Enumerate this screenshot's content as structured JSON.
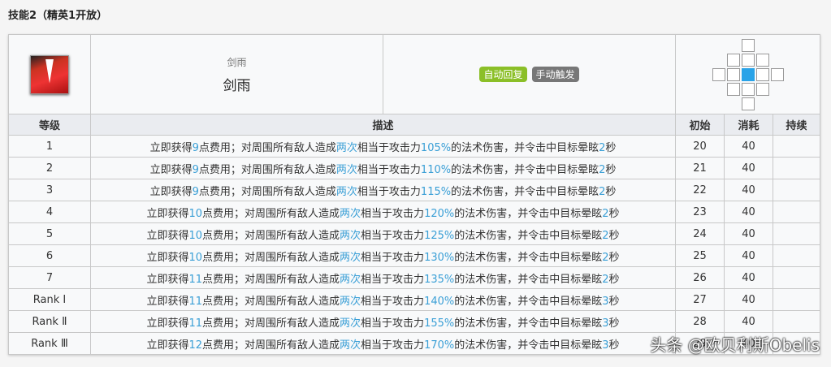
{
  "title": "技能2（精英1开放）",
  "skill": {
    "name_small": "剑雨",
    "name": "剑雨",
    "tags": [
      {
        "label": "自动回复",
        "color": "#8bbf27"
      },
      {
        "label": "手动触发",
        "color": "#777777"
      }
    ]
  },
  "headers": {
    "level": "等级",
    "desc": "描述",
    "initial": "初始",
    "cost": "消耗",
    "duration": "持续"
  },
  "desc_parts": [
    "立即获得",
    "点费用；对周围所有敌人造成",
    "两次",
    "相当于攻击力",
    "的法术伤害，并令击中目标晕眩",
    "秒"
  ],
  "rows": [
    {
      "level": "1",
      "sp": "9",
      "pct": "105%",
      "stun": "2",
      "initial": "20",
      "cost": "40",
      "duration": ""
    },
    {
      "level": "2",
      "sp": "9",
      "pct": "110%",
      "stun": "2",
      "initial": "21",
      "cost": "40",
      "duration": ""
    },
    {
      "level": "3",
      "sp": "9",
      "pct": "115%",
      "stun": "2",
      "initial": "22",
      "cost": "40",
      "duration": ""
    },
    {
      "level": "4",
      "sp": "10",
      "pct": "120%",
      "stun": "2",
      "initial": "23",
      "cost": "40",
      "duration": ""
    },
    {
      "level": "5",
      "sp": "10",
      "pct": "125%",
      "stun": "2",
      "initial": "24",
      "cost": "40",
      "duration": ""
    },
    {
      "level": "6",
      "sp": "10",
      "pct": "130%",
      "stun": "2",
      "initial": "25",
      "cost": "40",
      "duration": ""
    },
    {
      "level": "7",
      "sp": "11",
      "pct": "135%",
      "stun": "2",
      "initial": "26",
      "cost": "40",
      "duration": ""
    },
    {
      "level": "Rank Ⅰ",
      "sp": "11",
      "pct": "140%",
      "stun": "3",
      "initial": "27",
      "cost": "40",
      "duration": ""
    },
    {
      "level": "Rank Ⅱ",
      "sp": "11",
      "pct": "155%",
      "stun": "3",
      "initial": "28",
      "cost": "40",
      "duration": ""
    },
    {
      "level": "Rank Ⅲ",
      "sp": "12",
      "pct": "170%",
      "stun": "3",
      "initial": "29",
      "cost": "40",
      "duration": ""
    }
  ],
  "watermark": "头条 @欧贝利斯Obelis"
}
